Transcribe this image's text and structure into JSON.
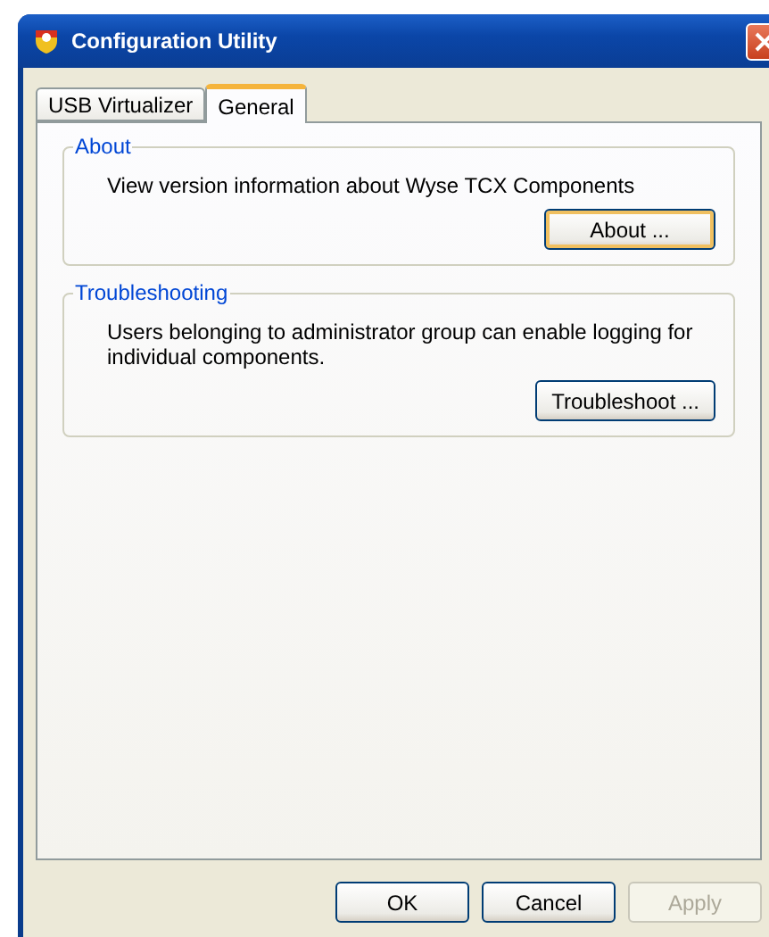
{
  "window": {
    "title": "Configuration Utility"
  },
  "tabs": [
    {
      "label": "USB Virtualizer",
      "selected": false
    },
    {
      "label": "General",
      "selected": true
    }
  ],
  "groups": [
    {
      "title": "About",
      "text": "View version information about Wyse TCX Components",
      "button": {
        "label": "About ...",
        "focused": true
      }
    },
    {
      "title": "Troubleshooting",
      "text": "Users belonging to administrator group can enable logging for individual components.",
      "button": {
        "label": "Troubleshoot ...",
        "focused": false
      }
    }
  ],
  "buttons": [
    {
      "label": "OK",
      "disabled": false
    },
    {
      "label": "Cancel",
      "disabled": false
    },
    {
      "label": "Apply",
      "disabled": true
    }
  ]
}
